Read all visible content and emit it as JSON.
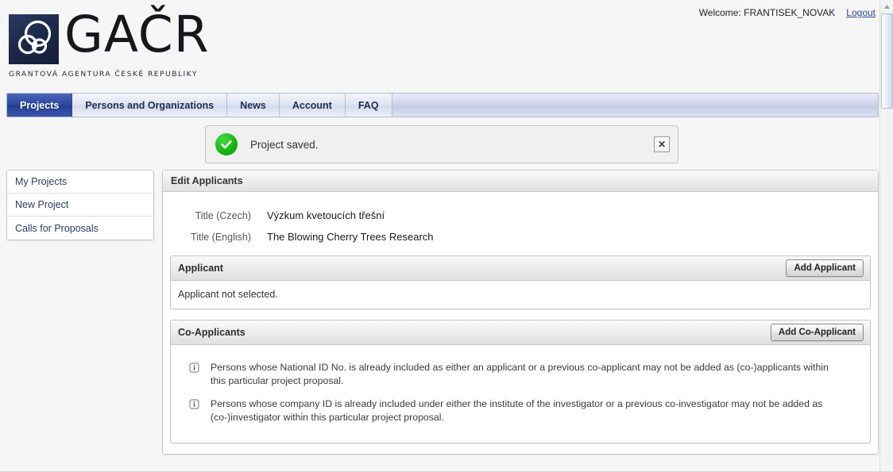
{
  "header": {
    "welcome_text": "Welcome: FRANTISEK_NOVAK",
    "logout_label": "Logout",
    "logo_wordmark": "GAČR",
    "logo_tagline": "GRANTOVÁ AGENTURA ČESKÉ REPUBLIKY",
    "brand_color": "#1b2747",
    "accent_color": "#2b49a0"
  },
  "nav": {
    "tabs": [
      {
        "label": "Projects",
        "active": true
      },
      {
        "label": "Persons and Organizations",
        "active": false
      },
      {
        "label": "News",
        "active": false
      },
      {
        "label": "Account",
        "active": false
      },
      {
        "label": "FAQ",
        "active": false
      }
    ]
  },
  "notification": {
    "icon": "success-check-icon",
    "message": "Project saved.",
    "close_label": "✕",
    "status_color": "#14b711"
  },
  "sidebar": {
    "items": [
      {
        "label": "My Projects"
      },
      {
        "label": "New Project"
      },
      {
        "label": "Calls for Proposals"
      }
    ]
  },
  "main": {
    "panel_title": "Edit Applicants",
    "fields": [
      {
        "label": "Title (Czech)",
        "value": "Výzkum kvetoucích třešní"
      },
      {
        "label": "Title (English)",
        "value": "The Blowing Cherry Trees Research"
      }
    ],
    "applicant_section": {
      "title": "Applicant",
      "button_label": "Add Applicant",
      "body_text": "Applicant not selected."
    },
    "coapplicant_section": {
      "title": "Co-Applicants",
      "button_label": "Add Co-Applicant",
      "notes": [
        "Persons whose National ID No. is already included as either an applicant or a previous co-applicant may not be added as (co-)applicants within this particular project proposal.",
        "Persons whose company ID is already included under either the institute of the investigator or a previous co-investigator may not be added as (co-)investigator within this particular project proposal."
      ]
    }
  }
}
